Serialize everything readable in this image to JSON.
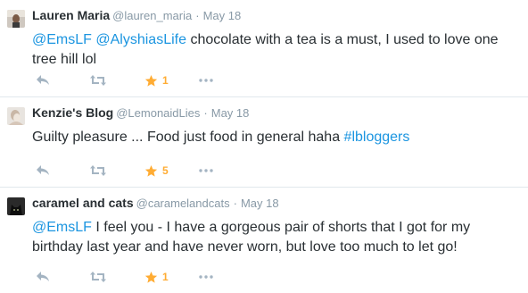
{
  "tweets": [
    {
      "name": "Lauren Maria",
      "handle": "@lauren_maria",
      "separator": "·",
      "time": "May 18",
      "mention1": "@EmsLF",
      "mention2": "@AlyshiasLife",
      "text": " chocolate with a tea is a must, I used to love one tree hill lol",
      "favorite_count": "1",
      "star_color": "#ffac33"
    },
    {
      "name": "Kenzie's Blog",
      "handle": "@LemonaidLies",
      "separator": "·",
      "time": "May 18",
      "text": "Guilty pleasure ... Food just food in general haha ",
      "hashtag": "#lbloggers",
      "favorite_count": "5",
      "star_color": "#ffac33"
    },
    {
      "name": "caramel and cats",
      "handle": "@caramelandcats",
      "separator": "·",
      "time": "May 18",
      "mention1": "@EmsLF",
      "text": " I feel you - I have a gorgeous pair of shorts that I got for my birthday last year and have never worn, but love too much to let go!",
      "favorite_count": "1",
      "star_color": "#ffac33"
    }
  ],
  "icons": {
    "reply": "reply-icon",
    "retweet": "retweet-icon",
    "favorite": "star-icon",
    "more": "more-icon"
  },
  "colors": {
    "link": "#1b95e0",
    "muted": "#8899a6",
    "icon": "#a4b4c2"
  }
}
